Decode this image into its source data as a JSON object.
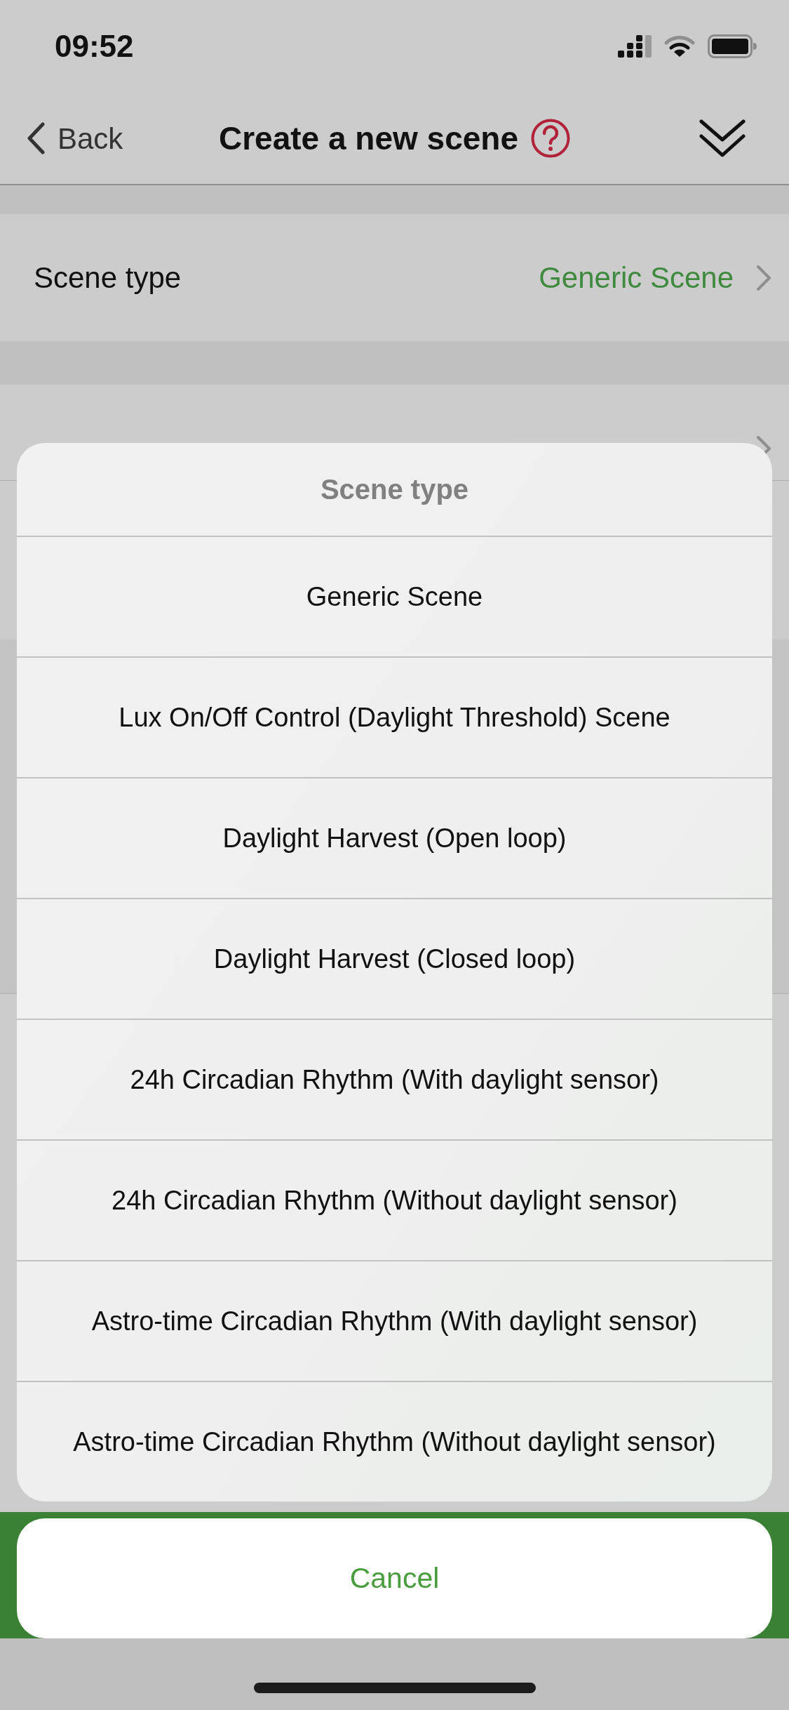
{
  "status_bar": {
    "time": "09:52"
  },
  "nav_bar": {
    "back_label": "Back",
    "title": "Create a new scene"
  },
  "settings_rows": [
    {
      "label": "Scene type",
      "value": "Generic Scene"
    }
  ],
  "action_sheet": {
    "title": "Scene type",
    "options": [
      "Generic Scene",
      "Lux On/Off Control (Daylight Threshold) Scene",
      "Daylight Harvest (Open loop)",
      "Daylight Harvest (Closed loop)",
      "24h Circadian Rhythm (With daylight sensor)",
      "24h Circadian Rhythm (Without daylight sensor)",
      "Astro-time Circadian Rhythm (With daylight sensor)",
      "Astro-time Circadian Rhythm (Without daylight sensor)"
    ],
    "cancel": "Cancel"
  }
}
